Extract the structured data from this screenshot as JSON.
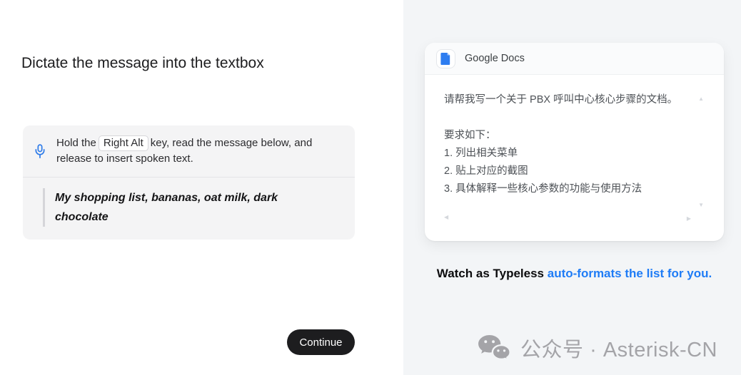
{
  "left": {
    "title": "Dictate the message into the textbox",
    "instruction": {
      "prefix": "Hold the",
      "key_label": "Right Alt",
      "suffix": "key, read the message below, and release to insert spoken text.",
      "mic_icon": "microphone-icon",
      "mic_color": "#2f7ce9"
    },
    "message_quote": "My shopping list, bananas, oat milk, dark chocolate",
    "continue_label": "Continue",
    "button_bg": "#1d1d1f"
  },
  "right": {
    "card": {
      "app_name": "Google Docs",
      "doc_icon": "google-docs-icon",
      "doc_icon_blue": "#2e7df0",
      "body_lines": [
        "请帮我写一个关于 PBX 呼叫中心核心步骤的文档。",
        "",
        "要求如下：",
        "1. 列出相关菜单",
        "2. 贴上对应的截图",
        "3. 具体解释一些核心参数的功能与使用方法"
      ],
      "scroll_arrows": {
        "up": "▲",
        "down": "▼",
        "left": "◀",
        "right": "▶"
      }
    },
    "caption": {
      "bold_black": "Watch as Typeless ",
      "bold_blue": "auto-formats the list for you.",
      "blue_color": "#1f7cf6"
    },
    "watermark": {
      "wechat_icon": "wechat-icon",
      "text": "公众号 · Asterisk-CN",
      "gray_color": "#a4a4a8"
    }
  }
}
